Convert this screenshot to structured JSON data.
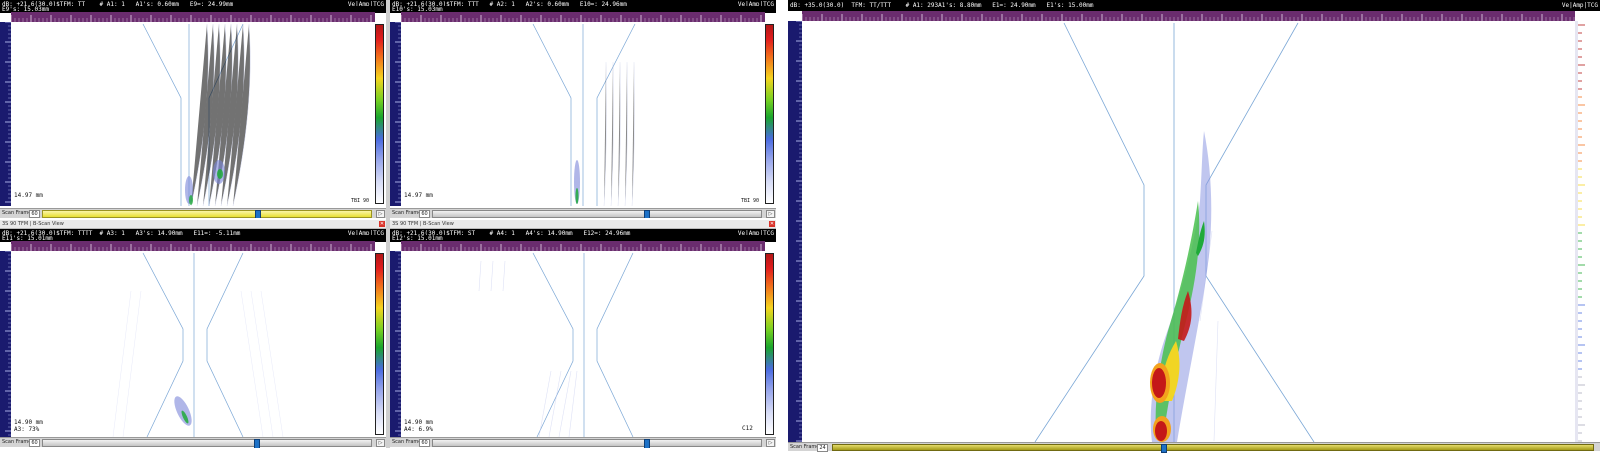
{
  "brand_label": "Ve|Amp|TCG",
  "scan_frame_label": "Scan Frame",
  "next_frame_glyph": "▷",
  "close_glyph": "✕",
  "colorbar_colors": [
    "#b31616",
    "#f2701c",
    "#f5d51f",
    "#19a52d",
    "#4a6be0",
    "#ffffff"
  ],
  "panels": [
    {
      "header_line1": "dB: +21.6(30.0)$TFM: TT    # A1: 1   A1's: 0.60mm   E9=: 24.99mm",
      "header_line2": "E9's: 15.03mm",
      "depth_readout": "14.97 mm",
      "corner_text": "TBI 90",
      "frame_value": "60",
      "slider_style": "yellow"
    },
    {
      "header_line1": "dB: +21.6(30.0)$TFM: TTT   # A2: 1   A2's: 0.60mm   E10=: 24.96mm",
      "header_line2": "E10's: 15.03mm",
      "depth_readout": "14.97 mm",
      "corner_text": "TBI 90",
      "frame_value": "60",
      "slider_style": "gray"
    },
    {
      "title_bar": "3S  90  TFM | B-Scan View",
      "header_line1": "dB: +21.6(30.0)$TFM: TTTT  # A3: 1   A3's: 14.90mm   E11=: -5.11mm",
      "header_line2": "E11's: 15.01mm",
      "depth_readout": "14.90 mm",
      "amp_readout": "A3: 73%",
      "frame_value": "60",
      "slider_style": "gray"
    },
    {
      "title_bar": "3S  90  TFM | B-Scan View",
      "header_line1": "dB: +21.6(30.0)$TFM: ST    # A4: 1   A4's: 14.90mm   E12=: 24.96mm",
      "header_line2": "E12's: 15.01mm",
      "depth_readout": "14.90 mm",
      "amp_readout": "A4: 6.9%",
      "corner_text": "C12",
      "frame_value": "60",
      "slider_style": "gray"
    },
    {
      "header_line1": "dB: +35.0(30.0)  TFM: TT/TTT    # A1: 293A1's: 8.80mm   E1=: 24.90mm   E1's: 15.00mm",
      "frame_value": "24",
      "slider_style": "olive"
    }
  ]
}
